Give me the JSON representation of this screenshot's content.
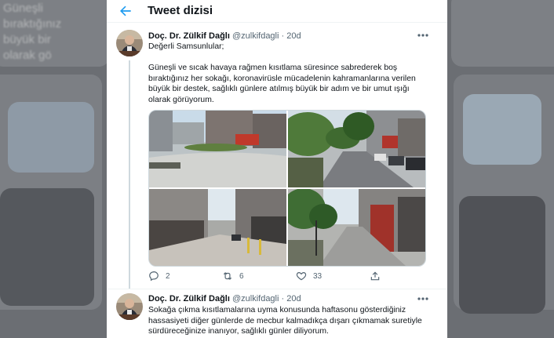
{
  "background": {
    "blurred_lines": [
      "Güneşli",
      "bıraktığınız",
      "büyük bir",
      "olarak gö"
    ]
  },
  "header": {
    "title": "Tweet dizisi",
    "back_icon": "arrow-left-icon",
    "accent_color": "#1d9bf0"
  },
  "tweets": [
    {
      "author_name": "Doç. Dr. Zülkif Dağlı",
      "handle": "@zulkifdagli",
      "separator": "·",
      "time": "20d",
      "text_lines": [
        "Değerli Samsunlular;",
        "",
        "Güneşli ve sıcak havaya rağmen kısıtlama süresince sabrederek boş",
        "bıraktığınız her sokağı, koronavirüsle mücadelenin kahramanlarına verilen",
        "büyük bir destek, sağlıklı günlere atılmış büyük bir adım ve bir umut ışığı",
        "olarak görüyorum."
      ],
      "actions": {
        "reply": "2",
        "retweet": "6",
        "like": "33"
      }
    },
    {
      "author_name": "Doç. Dr. Zülkif Dağlı",
      "handle": "@zulkifdagli",
      "separator": "·",
      "time": "20d",
      "text_lines": [
        "Sokağa çıkma kısıtlamalarına uyma konusunda haftasonu gösterdiğiniz",
        "hassasiyeti diğer günlerde de mecbur kalmadıkça dışarı çıkmamak suretiyle",
        "sürdüreceğinize inanıyor, sağlıklı günler diliyorum."
      ]
    }
  ]
}
